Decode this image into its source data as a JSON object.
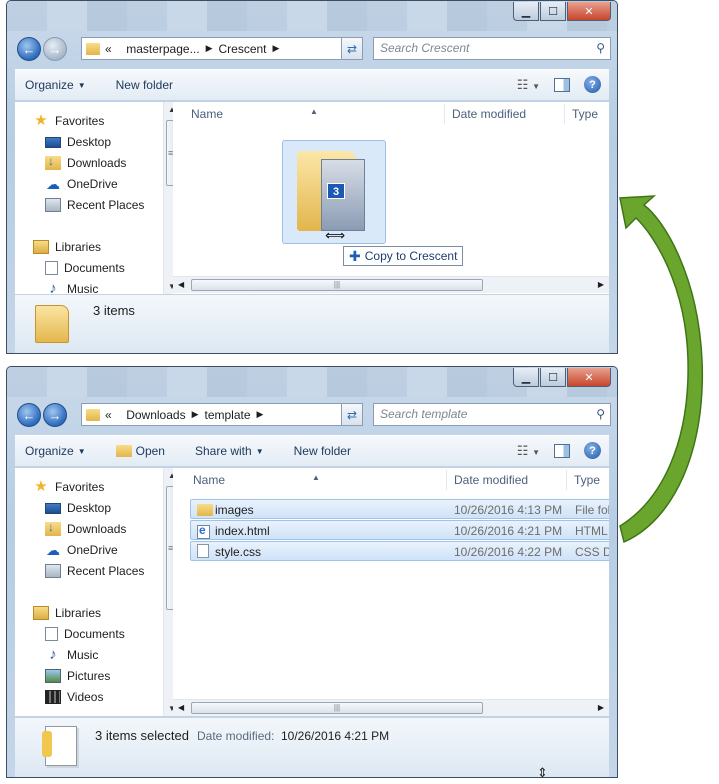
{
  "window1": {
    "address": {
      "overflow": "«",
      "segments": [
        "masterpage...",
        "Crescent"
      ]
    },
    "search_placeholder": "Search Crescent",
    "toolbar": {
      "organize": "Organize",
      "new_folder": "New folder"
    },
    "columns": {
      "name": "Name",
      "date": "Date modified",
      "type": "Type"
    },
    "nav": {
      "favorites": "Favorites",
      "desktop": "Desktop",
      "downloads": "Downloads",
      "onedrive": "OneDrive",
      "recent": "Recent Places",
      "libraries": "Libraries",
      "documents": "Documents",
      "music": "Music"
    },
    "drag": {
      "badge": "3",
      "tooltip": "Copy to Crescent"
    },
    "details": {
      "count": "3 items"
    }
  },
  "window2": {
    "address": {
      "overflow": "«",
      "segments": [
        "Downloads",
        "template"
      ]
    },
    "search_placeholder": "Search template",
    "toolbar": {
      "organize": "Organize",
      "open": "Open",
      "share": "Share with",
      "new_folder": "New folder"
    },
    "columns": {
      "name": "Name",
      "date": "Date modified",
      "type": "Type"
    },
    "nav": {
      "favorites": "Favorites",
      "desktop": "Desktop",
      "downloads": "Downloads",
      "onedrive": "OneDrive",
      "recent": "Recent Places",
      "libraries": "Libraries",
      "documents": "Documents",
      "music": "Music",
      "pictures": "Pictures",
      "videos": "Videos"
    },
    "files": [
      {
        "name": "images",
        "date": "10/26/2016 4:13 PM",
        "type": "File fold",
        "icon": "folder-icon"
      },
      {
        "name": "index.html",
        "date": "10/26/2016 4:21 PM",
        "type": "HTML",
        "icon": "html-file-icon"
      },
      {
        "name": "style.css",
        "date": "10/26/2016 4:22 PM",
        "type": "CSS Do",
        "icon": "css-file-icon"
      }
    ],
    "details": {
      "count": "3 items selected",
      "date_label": "Date modified:",
      "date_value": "10/26/2016 4:21 PM"
    }
  },
  "colors": {
    "arrow": "#6aa62e",
    "selection": "#cfe3f8",
    "titlebar": "#c9d9ea"
  }
}
